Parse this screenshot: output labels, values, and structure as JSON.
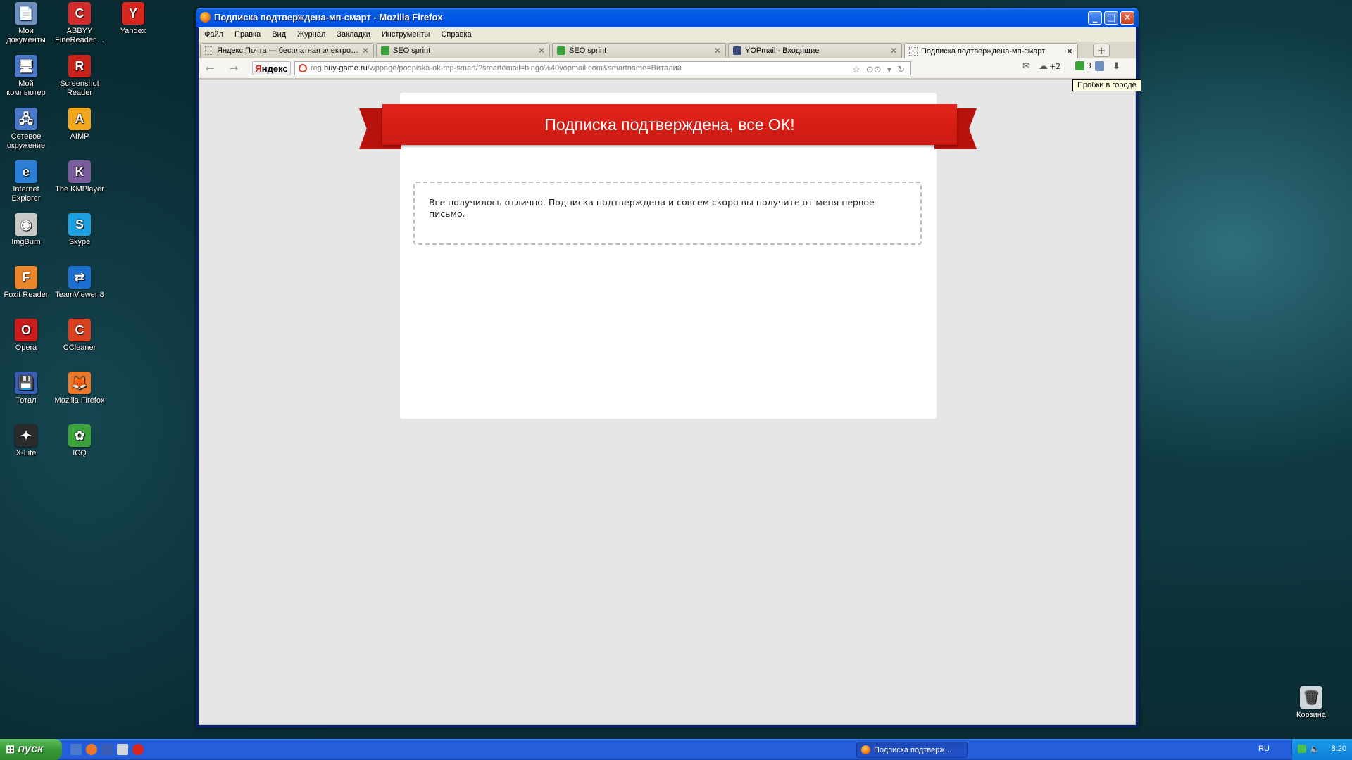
{
  "desktop": {
    "icons": [
      {
        "label": "Мои\nдокументы",
        "color": "#6f8fbf",
        "glyph": "📄"
      },
      {
        "label": "ABBYY\nFineReader ...",
        "color": "#d32b2b",
        "glyph": "C"
      },
      {
        "label": "Yandex",
        "color": "#d8261f",
        "glyph": "Y"
      },
      {
        "label": "Мой\nкомпьютер",
        "color": "#4a79c9",
        "glyph": "🖥"
      },
      {
        "label": "Screenshot\nReader",
        "color": "#c8241c",
        "glyph": "R"
      },
      {
        "label": "Сетевое\nокружение",
        "color": "#4a79c9",
        "glyph": "🖧"
      },
      {
        "label": "AIMP",
        "color": "#f1a81c",
        "glyph": "A"
      },
      {
        "label": "Internet\nExplorer",
        "color": "#2c7fd6",
        "glyph": "e"
      },
      {
        "label": "The KMPlayer",
        "color": "#7a5c9e",
        "glyph": "K"
      },
      {
        "label": "ImgBurn",
        "color": "#c9c9c9",
        "glyph": "◉"
      },
      {
        "label": "Skype",
        "color": "#1ba1e2",
        "glyph": "S"
      },
      {
        "label": "Foxit Reader",
        "color": "#e9862b",
        "glyph": "F"
      },
      {
        "label": "TeamViewer 8",
        "color": "#1b6fd0",
        "glyph": "⇄"
      },
      {
        "label": "Opera",
        "color": "#cc1b1b",
        "glyph": "O"
      },
      {
        "label": "CCleaner",
        "color": "#d8411f",
        "glyph": "C"
      },
      {
        "label": "Тотал",
        "color": "#3b5db3",
        "glyph": "💾"
      },
      {
        "label": "Mozilla Firefox",
        "color": "#e9782b",
        "glyph": "🦊"
      },
      {
        "label": "X-Lite",
        "color": "#2a2a2a",
        "glyph": "✦"
      },
      {
        "label": "ICQ",
        "color": "#3aa33a",
        "glyph": "✿"
      }
    ],
    "recycle_bin": "Корзина"
  },
  "window": {
    "title": "Подписка подтверждена-мп-смарт - Mozilla Firefox",
    "buttons": {
      "minimize": "_",
      "maximize": "□",
      "close": "✕"
    }
  },
  "menu": [
    "Файл",
    "Правка",
    "Вид",
    "Журнал",
    "Закладки",
    "Инструменты",
    "Справка"
  ],
  "tabs": [
    {
      "label": "Яндекс.Почта — бесплатная электрон...",
      "icon": "page-icon",
      "active": false
    },
    {
      "label": "SEO sprint",
      "icon": "seosprint-icon",
      "active": false
    },
    {
      "label": "SEO sprint",
      "icon": "seosprint-icon",
      "active": false
    },
    {
      "label": "YOPmail - Входящие",
      "icon": "yopmail-icon",
      "active": false
    },
    {
      "label": "Подписка подтверждена-мп-смарт",
      "icon": "page-icon",
      "active": true
    }
  ],
  "newtab_label": "+",
  "navbar": {
    "back": "←",
    "forward": "→",
    "yandex_first": "Я",
    "yandex_rest": "ндекс",
    "url_host_pre": "reg.",
    "url_host": "buy-game.ru",
    "url_path": "/wppage/podpiska-ok-mp-smart/?smartemail=bingo%40yopmail.com&smartname=Виталий",
    "bookmark_star": "☆",
    "reader": "⊙⊙",
    "dropdown": "▾",
    "reload": "↻",
    "mail": "✉",
    "weather": "☁",
    "weather_value": "+2",
    "traffic_value": "3",
    "download": "⬇"
  },
  "tooltip": "Пробки в городе",
  "page": {
    "ribbon_title": "Подписка подтверждена, все ОК!",
    "message": "Все получилось отлично. Подписка подтверждена и совсем скоро вы получите от меня первое письмо."
  },
  "taskbar": {
    "start_label": "пуск",
    "task_label": "Подписка подтверж...",
    "language": "RU",
    "clock": "8:20"
  },
  "colors": {
    "ribbon": "#d81e16",
    "xp_blue": "#245edb",
    "start_green": "#379937"
  }
}
